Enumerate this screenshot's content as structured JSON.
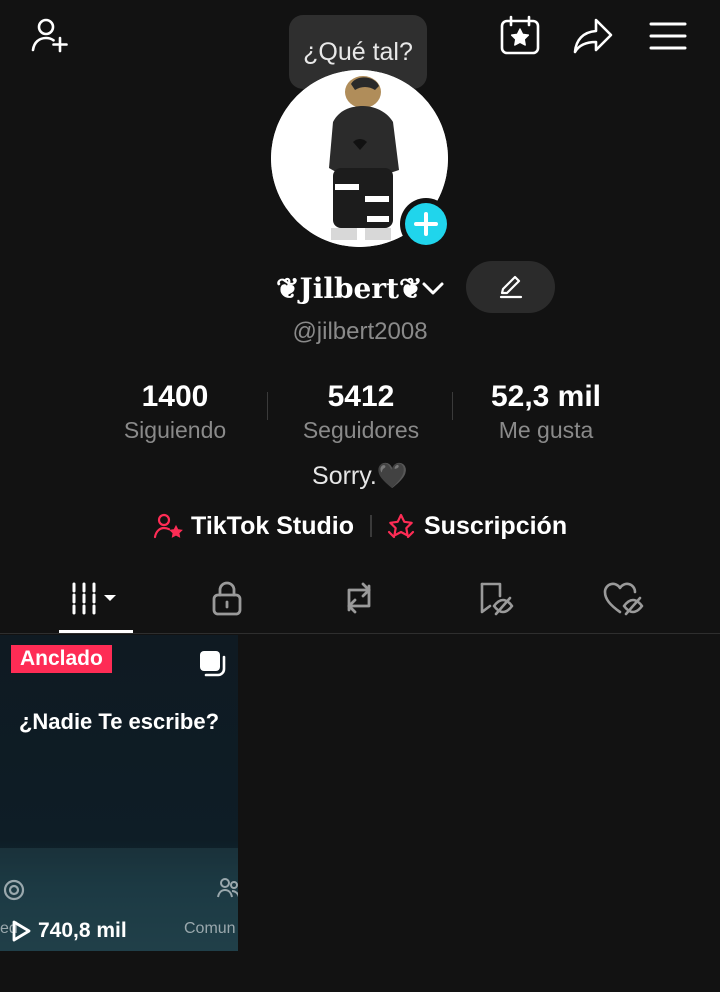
{
  "tooltip": {
    "text": "¿Qué tal?"
  },
  "profile": {
    "display_name": "❦Jilbert❦",
    "username": "@jilbert2008",
    "bio": "Sorry.🖤"
  },
  "stats": [
    {
      "value": "1400",
      "label": "Siguiendo"
    },
    {
      "value": "5412",
      "label": "Seguidores"
    },
    {
      "value": "52,3 mil",
      "label": "Me gusta"
    }
  ],
  "links": {
    "studio": "TikTok Studio",
    "subscription": "Suscripción"
  },
  "tabs": [
    {
      "name": "videos",
      "icon": "grid-icon",
      "active": true
    },
    {
      "name": "private",
      "icon": "lock-icon"
    },
    {
      "name": "reposts",
      "icon": "repost-icon"
    },
    {
      "name": "favorites",
      "icon": "bookmark-hidden-icon"
    },
    {
      "name": "liked",
      "icon": "heart-hidden-icon"
    }
  ],
  "videos": [
    {
      "pinned_label": "Anclado",
      "caption": "¿Nadie Te escribe?",
      "views": "740,8 mil",
      "overlay_left": "ed",
      "overlay_right": "Comun"
    }
  ],
  "colors": {
    "background": "#121212",
    "accent_red": "#fe2c55",
    "accent_cyan": "#20d5ec",
    "muted_text": "#8a8a8a"
  }
}
